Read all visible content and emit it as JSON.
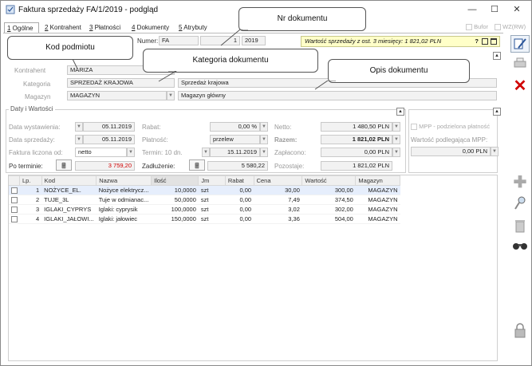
{
  "window": {
    "title": "Faktura sprzedaży FA/1/2019 - podgląd",
    "min": "—",
    "max": "☐",
    "close": "✕"
  },
  "tabs": [
    {
      "key": "1",
      "label": " Ogólne"
    },
    {
      "key": "2",
      "label": " Kontrahent"
    },
    {
      "key": "3",
      "label": " Płatności"
    },
    {
      "key": "4",
      "label": " Dokumenty"
    },
    {
      "key": "5",
      "label": " Atrybuty"
    }
  ],
  "top_checks": {
    "bufor": "Bufor",
    "wz": "WZ(RW)"
  },
  "numer": {
    "label": "Numer:",
    "prefix": "FA",
    "number": "1",
    "year": "2019"
  },
  "warning": "Wartość sprzedaży z ost. 3 miesięcy: 1 821,02 PLN",
  "warning_q": "?",
  "callouts": {
    "kod": "Kod podmiotu",
    "nr": "Nr dokumentu",
    "kategoria": "Kategoria dokumentu",
    "opis": "Opis dokumentu"
  },
  "header": {
    "kontrahent_label": "Kontrahent",
    "kontrahent": "MARIZA",
    "kategoria_label": "Kategoria",
    "kategoria": "SPRZEDAŻ KRAJOWA",
    "kategoria_opis": "Sprzedaż krajowa",
    "magazyn_label": "Magazyn",
    "magazyn": "MAGAZYN",
    "magazyn_opis": "Magazyn główny"
  },
  "daty": {
    "title": "Daty i Wartości",
    "wyst_label": "Data wystawienia:",
    "wyst": "05.11.2019",
    "sprz_label": "Data sprzedaży:",
    "sprz": "05.11.2019",
    "liczona_label": "Faktura liczona od:",
    "liczona": "netto",
    "po_terminie_label": "Po terminie:",
    "po_terminie": "3 759,20",
    "rabat_label": "Rabat:",
    "rabat": "0,00 %",
    "platnosc_label": "Płatność:",
    "platnosc": "przelew",
    "termin_label": "Termin: 10 dn.",
    "termin": "15.11.2019",
    "zadluzenie_label": "Zadłużenie:",
    "zadluzenie": "5 580,22",
    "netto_label": "Netto:",
    "netto": "1 480,50 PLN",
    "razem_label": "Razem:",
    "razem": "1 821,02 PLN",
    "zaplacono_label": "Zapłacono:",
    "zaplacono": "0,00 PLN",
    "pozostaje_label": "Pozostaje:",
    "pozostaje": "1 821,02 PLN",
    "mpp_label": "MPP - podzielona płatność",
    "mpp_wart_label": "Wartość podlegająca MPP:",
    "mpp_wart": "0,00 PLN"
  },
  "table": {
    "headers": [
      "Lp.",
      "Kod",
      "Nazwa",
      "Ilość",
      "Jm",
      "Rabat",
      "Cena",
      "Wartość",
      "Magazyn"
    ],
    "rows": [
      {
        "lp": "1",
        "kod": "NOŻYCE_EL.",
        "nazwa": "Nożyce elektrycz...",
        "ilosc": "10,0000",
        "jm": "szt",
        "rabat": "0,00",
        "cena": "30,00",
        "wartosc": "300,00",
        "magazyn": "MAGAZYN"
      },
      {
        "lp": "2",
        "kod": "TUJE_3L",
        "nazwa": "Tuje w odmianac...",
        "ilosc": "50,0000",
        "jm": "szt",
        "rabat": "0,00",
        "cena": "7,49",
        "wartosc": "374,50",
        "magazyn": "MAGAZYN"
      },
      {
        "lp": "3",
        "kod": "IGLAKI_CYPRYS",
        "nazwa": "Iglaki: cyprysik",
        "ilosc": "100,0000",
        "jm": "szt",
        "rabat": "0,00",
        "cena": "3,02",
        "wartosc": "302,00",
        "magazyn": "MAGAZYN"
      },
      {
        "lp": "4",
        "kod": "IGLAKI_JAŁOWI...",
        "nazwa": "Iglaki: jałowiec",
        "ilosc": "150,0000",
        "jm": "szt",
        "rabat": "0,00",
        "cena": "3,36",
        "wartosc": "504,00",
        "magazyn": "MAGAZYN"
      }
    ]
  },
  "colors": {
    "red": "#d00000",
    "warn_bg": "#ffffc8"
  }
}
